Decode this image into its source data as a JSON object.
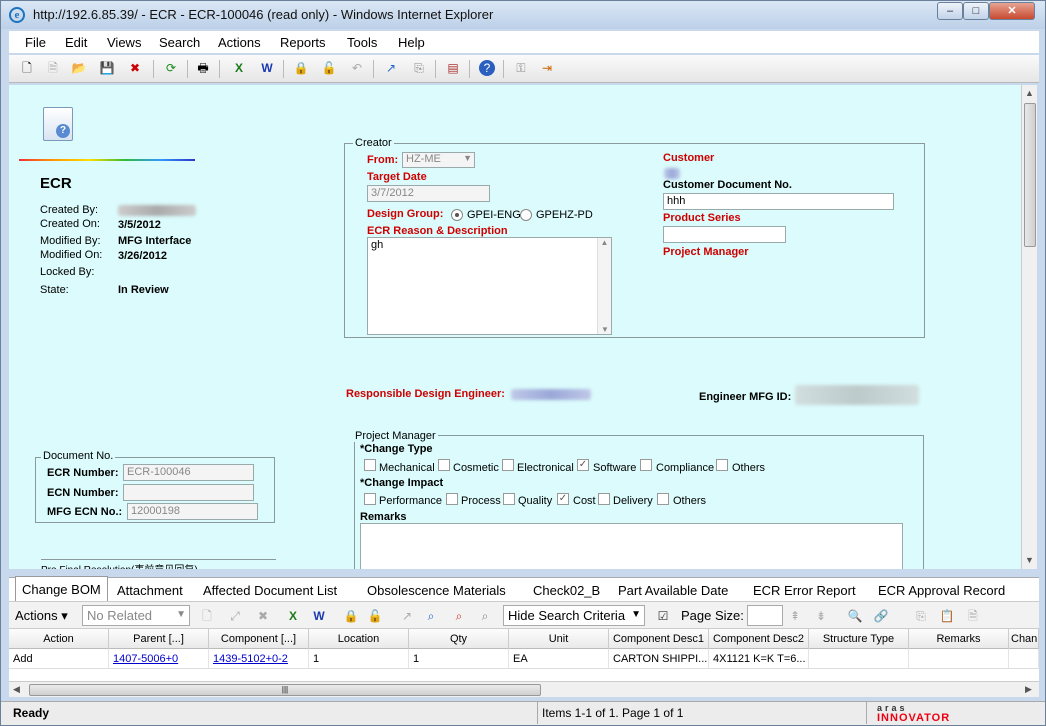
{
  "window": {
    "title": "http://192.6.85.39/ - ECR - ECR-100046 (read only) - Windows Internet Explorer",
    "min": "–",
    "max": "□",
    "close": "✕"
  },
  "menu": [
    "File",
    "Edit",
    "Views",
    "Search",
    "Actions",
    "Reports",
    "Tools",
    "Help"
  ],
  "sidebar": {
    "item_type": "ECR",
    "created_by_label": "Created By:",
    "created_on_label": "Created On:",
    "created_on": "3/5/2012",
    "modified_by_label": "Modified By:",
    "modified_by": "MFG Interface",
    "modified_on_label": "Modified On:",
    "modified_on": "3/26/2012",
    "locked_by_label": "Locked By:",
    "state_label": "State:",
    "state": "In Review"
  },
  "document_no": {
    "legend": "Document No.",
    "ecr_number_label": "ECR Number:",
    "ecr_number": "ECR-100046",
    "ecn_number_label": "ECN Number:",
    "ecn_number": "",
    "mfg_ecn_label": "MFG ECN No.:",
    "mfg_ecn": "12000198"
  },
  "pre_final_resolution": "Pre Final Resolution(事前意见回复)",
  "creator": {
    "legend": "Creator",
    "from_label": "From:",
    "from_value": "HZ-ME",
    "target_date_label": "Target Date",
    "target_date": "3/7/2012",
    "design_group_label": "Design Group:",
    "design_group_opt1": "GPEI-ENG",
    "design_group_opt2": "GPEHZ-PD",
    "reason_label": "ECR Reason & Description",
    "reason": "gh",
    "customer_label": "Customer",
    "customer_doc_label": "Customer Document No.",
    "customer_doc": "hhh",
    "product_series_label": "Product Series",
    "product_series": "",
    "project_manager_label": "Project Manager"
  },
  "responsible_engineer_label": "Responsible Design Engineer:",
  "engineer_mfg_label": "Engineer MFG ID:",
  "pm": {
    "legend": "Project Manager",
    "change_type_label": "*Change Type",
    "change_type": [
      {
        "label": "Mechanical",
        "checked": false
      },
      {
        "label": "Cosmetic",
        "checked": false
      },
      {
        "label": "Electronical",
        "checked": false
      },
      {
        "label": "Software",
        "checked": true
      },
      {
        "label": "Compliance",
        "checked": false
      },
      {
        "label": "Others",
        "checked": false
      }
    ],
    "change_impact_label": "*Change Impact",
    "change_impact": [
      {
        "label": "Performance",
        "checked": false
      },
      {
        "label": "Process",
        "checked": false
      },
      {
        "label": "Quality",
        "checked": false
      },
      {
        "label": "Cost",
        "checked": true
      },
      {
        "label": "Delivery",
        "checked": false
      },
      {
        "label": "Others",
        "checked": false
      }
    ],
    "remarks_label": "Remarks",
    "remarks": ""
  },
  "tabs": [
    "Change BOM",
    "Attachment",
    "Affected Document List",
    "Obsolescence Materials",
    "Check02_B",
    "Part Available Date",
    "ECR Error Report",
    "ECR Approval Record"
  ],
  "grid_toolbar": {
    "actions": "Actions",
    "related": "No Related",
    "hide_search": "Hide Search Criteria",
    "page_size": "Page Size:"
  },
  "grid": {
    "columns": [
      "Action",
      "Parent [...]",
      "Component [...]",
      "Location",
      "Qty",
      "Unit",
      "Component Desc1",
      "Component Desc2",
      "Structure Type",
      "Remarks",
      "Chan"
    ],
    "rows": [
      [
        "Add",
        "1407-5006+0",
        "1439-5102+0-2",
        "1",
        "1",
        "EA",
        "CARTON SHIPPI...",
        "4X1121 K=K T=6...",
        "",
        "",
        ""
      ]
    ]
  },
  "status": {
    "ready": "Ready",
    "items": "Items 1-1 of 1. Page 1 of 1",
    "logo": "aras",
    "logo2": "INNOVATOR"
  }
}
